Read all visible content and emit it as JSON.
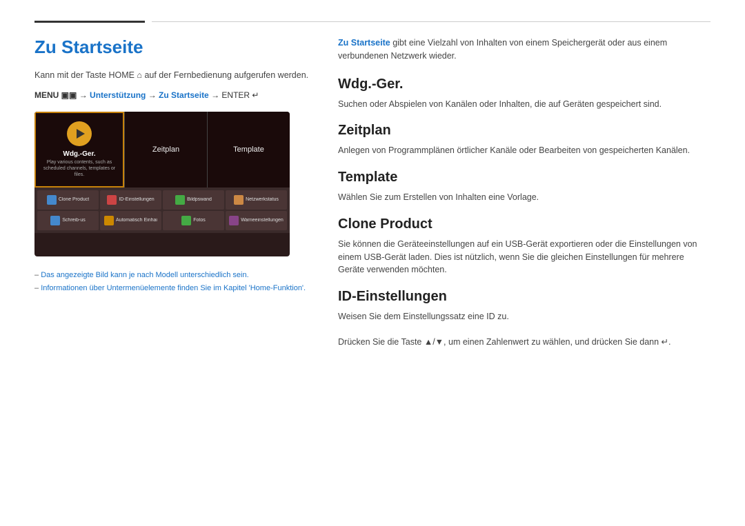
{
  "header": {
    "divider_left_label": "divider-left",
    "divider_right_label": "divider-right"
  },
  "left": {
    "title": "Zu Startseite",
    "intro": "Kann mit der Taste HOME ⌂ auf der Fernbedienung aufgerufen werden.",
    "menu_path_bold": "MENU ▣▣",
    "menu_path_arrow1": "→",
    "menu_path_link1": "Unterstützung",
    "menu_path_arrow2": "→",
    "menu_path_link2": "Zu Startseite",
    "menu_path_arrow3": "→ ENTER ↵",
    "tv": {
      "wdg_title": "Wdg.-Ger.",
      "wdg_sub": "Play various contents, such as scheduled channels, templates or files.",
      "zeitplan": "Zeitplan",
      "template": "Template",
      "grid_items": [
        {
          "label": "Clone Product",
          "color": "#4488cc"
        },
        {
          "label": "ID-Einstellungen",
          "color": "#cc4444"
        },
        {
          "label": "Bildpswand",
          "color": "#44aa44"
        },
        {
          "label": "Netzwerkstatus",
          "color": "#cc8844"
        },
        {
          "label": "Schreib-us",
          "color": "#4488cc"
        },
        {
          "label": "Automatisch Einhai",
          "color": "#cc8800"
        },
        {
          "label": "Fotos",
          "color": "#44aa44"
        },
        {
          "label": "Warneeinstellungen",
          "color": "#884488"
        }
      ]
    },
    "notes": [
      "Das angezeigte Bild kann je nach Modell unterschiedlich sein.",
      "Informationen über Untermenüelemente finden Sie im Kapitel 'Home-Funktion'."
    ]
  },
  "right": {
    "intro_link": "Zu Startseite",
    "intro_text": " gibt eine Vielzahl von Inhalten von einem Speichergerät oder aus einem verbundenen Netzwerk wieder.",
    "sections": [
      {
        "heading": "Wdg.-Ger.",
        "text": "Suchen oder Abspielen von Kanälen oder Inhalten, die auf Geräten gespeichert sind."
      },
      {
        "heading": "Zeitplan",
        "text": "Anlegen von Programmplänen örtlicher Kanäle oder Bearbeiten von gespeicherten Kanälen."
      },
      {
        "heading": "Template",
        "text": "Wählen Sie zum Erstellen von Inhalten eine Vorlage."
      },
      {
        "heading": "Clone Product",
        "text": "Sie können die Geräteeinstellungen auf ein USB-Gerät exportieren oder die Einstellungen von einem USB-Gerät laden. Dies ist nützlich, wenn Sie die gleichen Einstellungen für mehrere Geräte verwenden möchten."
      },
      {
        "heading": "ID-Einstellungen",
        "text1": "Weisen Sie dem Einstellungssatz eine ID zu.",
        "text2": "Drücken Sie die Taste ▲/▼, um einen Zahlenwert zu wählen, und drücken Sie dann ↵."
      }
    ]
  }
}
